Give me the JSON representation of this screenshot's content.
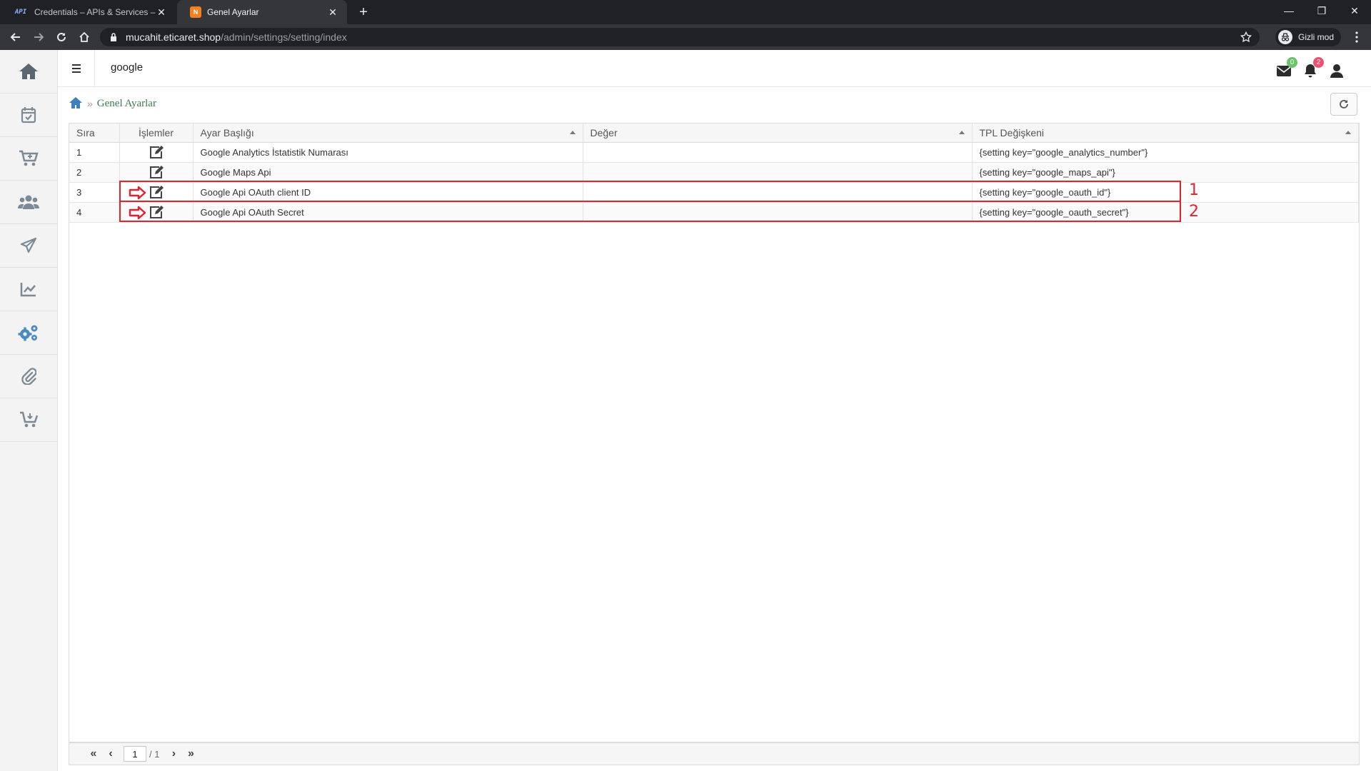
{
  "browser": {
    "tabs": [
      {
        "favicon": "API",
        "title": "Credentials – APIs & Services – El"
      },
      {
        "favicon": "N",
        "title": "Genel Ayarlar"
      }
    ],
    "url_host": "mucahit.eticaret.shop",
    "url_path": "/admin/settings/setting/index",
    "incognito_label": "Gizli mod"
  },
  "sidebar": {
    "items": [
      "home-icon",
      "calendar-check-icon",
      "cart-icon",
      "users-icon",
      "paper-plane-icon",
      "chart-icon",
      "gears-icon",
      "paperclip-icon",
      "cart-arrow-icon"
    ],
    "active_index": 6
  },
  "topbar": {
    "search_text": "google",
    "mail_count": "0",
    "notification_count": "2"
  },
  "breadcrumb": {
    "current": "Genel Ayarlar"
  },
  "table": {
    "columns": [
      "Sıra",
      "İşlemler",
      "Ayar Başlığı",
      "Değer",
      "TPL Değişkeni"
    ],
    "rows": [
      {
        "no": "1",
        "title": "Google Analytics İstatistik Numarası",
        "value": "",
        "tpl": "{setting key=\"google_analytics_number\"}"
      },
      {
        "no": "2",
        "title": "Google Maps Api",
        "value": "",
        "tpl": "{setting key=\"google_maps_api\"}"
      },
      {
        "no": "3",
        "title": "Google Api OAuth client ID",
        "value": "",
        "tpl": "{setting key=\"google_oauth_id\"}"
      },
      {
        "no": "4",
        "title": "Google Api OAuth Secret",
        "value": "",
        "tpl": "{setting key=\"google_oauth_secret\"}"
      }
    ]
  },
  "annotations": [
    "1",
    "2"
  ],
  "pager": {
    "page": "1",
    "total": "/ 1"
  },
  "colors": {
    "highlight": "#e4222e",
    "breadcrumb_text": "#3d7b4f",
    "active_sidebar": "#4a89c5"
  }
}
